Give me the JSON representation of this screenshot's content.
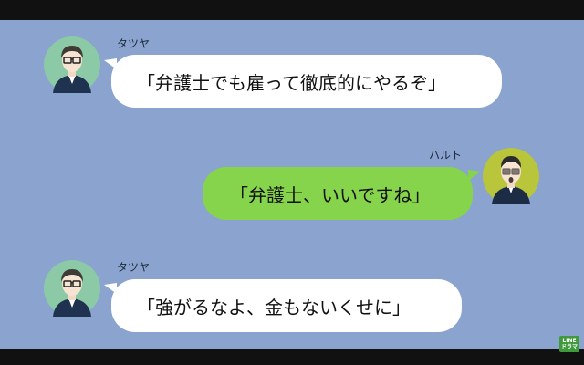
{
  "messages": [
    {
      "sender": "タツヤ",
      "text": "「弁護士でも雇って徹底的にやるぞ」",
      "side": "left"
    },
    {
      "sender": "ハルト",
      "text": "「弁護士、いいですね」",
      "side": "right"
    },
    {
      "sender": "タツヤ",
      "text": "「強がるなよ、金もないくせに」",
      "side": "left"
    }
  ],
  "logo": {
    "line1": "LINE",
    "line2": "ドラマ"
  },
  "colors": {
    "background": "#8aa3cf",
    "left_bubble": "#ffffff",
    "right_bubble": "#86d44b"
  }
}
